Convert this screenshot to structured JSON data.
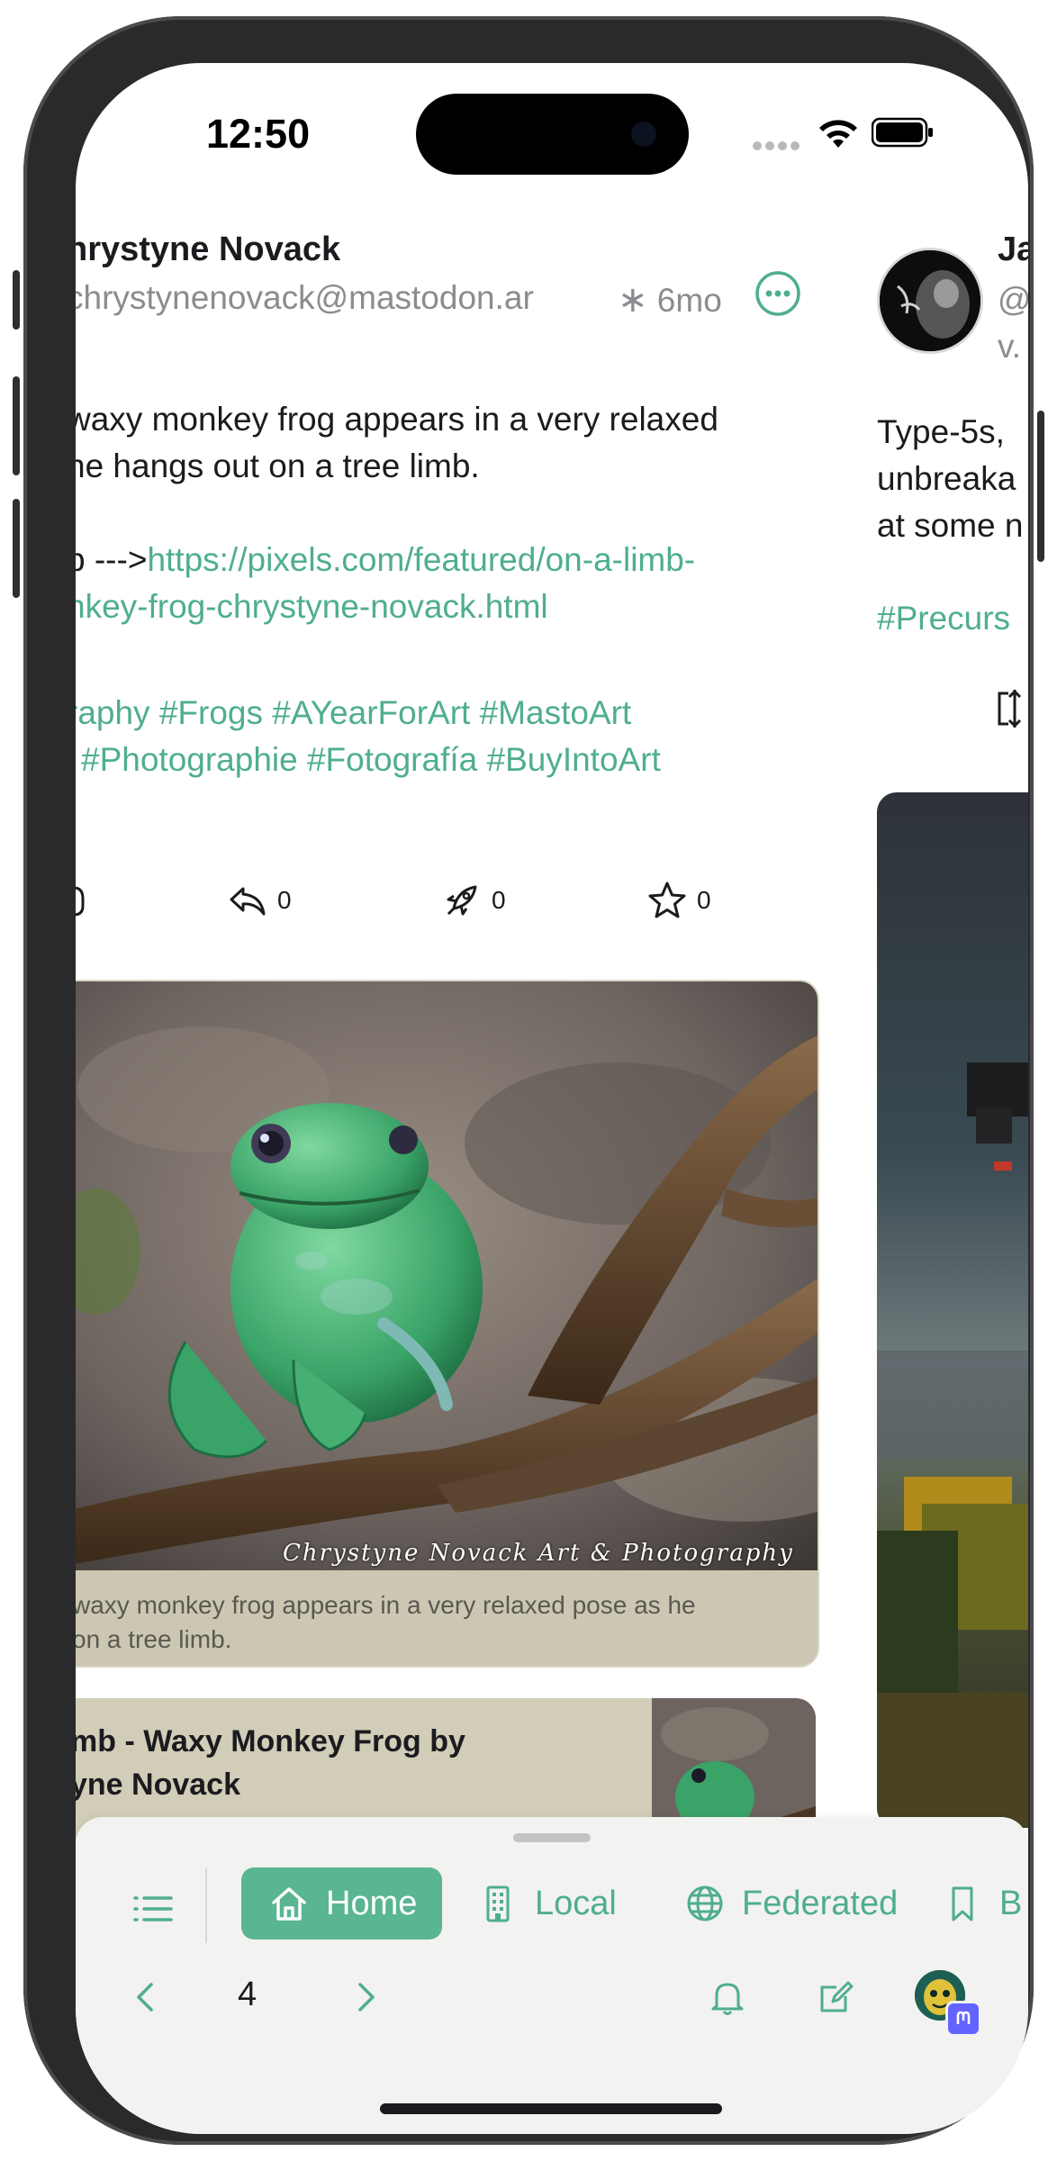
{
  "status_bar": {
    "time": "12:50"
  },
  "left_post": {
    "author_name": "hrystyne Novack",
    "author_handle": "chrystynenovack@mastodon.ar",
    "time_ago": "6mo",
    "text_lines": [
      "waxy monkey frog appears in a very relaxed",
      "he hangs out on a tree limb."
    ],
    "link_prefix": "b --->",
    "link_line1": "https://pixels.com/featured/on-a-limb-",
    "link_line2": "nkey-frog-chrystyne-novack.html",
    "tags_line1": "raphy #Frogs #AYearForArt #MastoArt",
    "tags_line2": "#Photographie #Fotografía #BuyIntoArt",
    "actions": {
      "reply_count": "0",
      "boost_count": "0",
      "favorite_count": "0"
    },
    "media": {
      "watermark": "Chrystyne Novack Art & Photography",
      "alt_line1": "waxy monkey frog appears in a very relaxed pose as he",
      "alt_line2": "on a tree limb."
    },
    "link_card": {
      "title_line1": "mb - Waxy Monkey Frog by",
      "title_line2": "yne Novack"
    }
  },
  "right_post": {
    "author_name": "Ja",
    "author_handle": "@",
    "author_handle2": "v.",
    "text_lines": [
      "Type-5s,",
      "unbreaka",
      "at some n"
    ],
    "tag": "#Precurs"
  },
  "bottom_bar": {
    "tabs": [
      {
        "label": "Home",
        "icon": "home-icon",
        "active": true
      },
      {
        "label": "Local",
        "icon": "building-icon",
        "active": false
      },
      {
        "label": "Federated",
        "icon": "globe-icon",
        "active": false
      },
      {
        "label": "B",
        "icon": "bookmark-icon",
        "active": false
      }
    ],
    "page_number": "4"
  },
  "colors": {
    "accent": "#4fae8d",
    "active_tab_bg": "#5ab592",
    "secondary_text": "#8b8b90",
    "card_bg": "#ccc7b3"
  }
}
